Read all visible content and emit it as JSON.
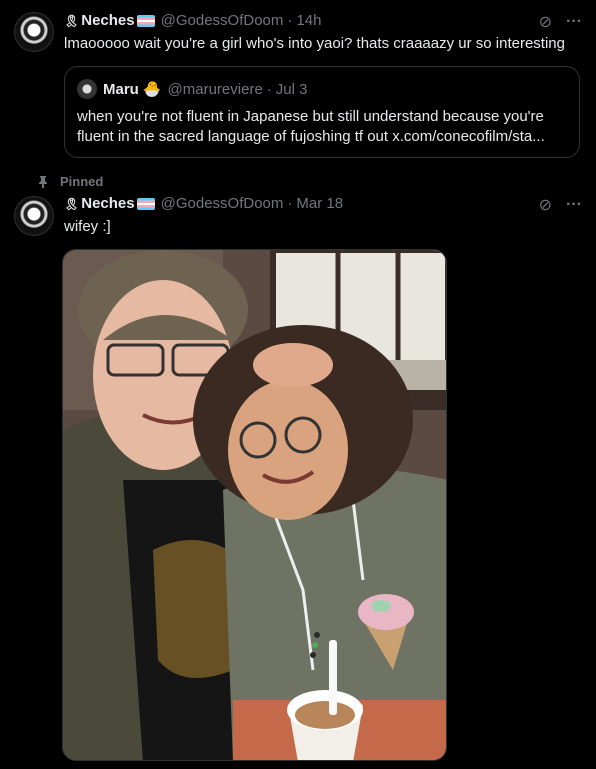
{
  "tweet1": {
    "display_name": "Neches",
    "handle": "@GodessOfDoom",
    "separator": "·",
    "time": "14h",
    "text": "lmaooooo wait you're a girl who's into yaoi? thats craaaazy ur so interesting",
    "quote": {
      "display_name": "Maru",
      "emoji": "🐣",
      "handle": "@marureviere",
      "separator": "·",
      "time": "Jul 3",
      "text": "when you're not fluent in Japanese but still understand because you're fluent in the sacred language of fujoshing tf out x.com/conecofilm/sta..."
    }
  },
  "pinned_label": "Pinned",
  "tweet2": {
    "display_name": "Neches",
    "handle": "@GodessOfDoom",
    "separator": "·",
    "time": "Mar 18",
    "text": "wifey :]"
  },
  "icons": {
    "ribbon": "🎗",
    "grok": "⊘",
    "more": "···",
    "pin": "📌"
  },
  "colors": {
    "background": "#000000",
    "text": "#e7e9ea",
    "muted": "#71767b",
    "border": "#2f3336"
  }
}
